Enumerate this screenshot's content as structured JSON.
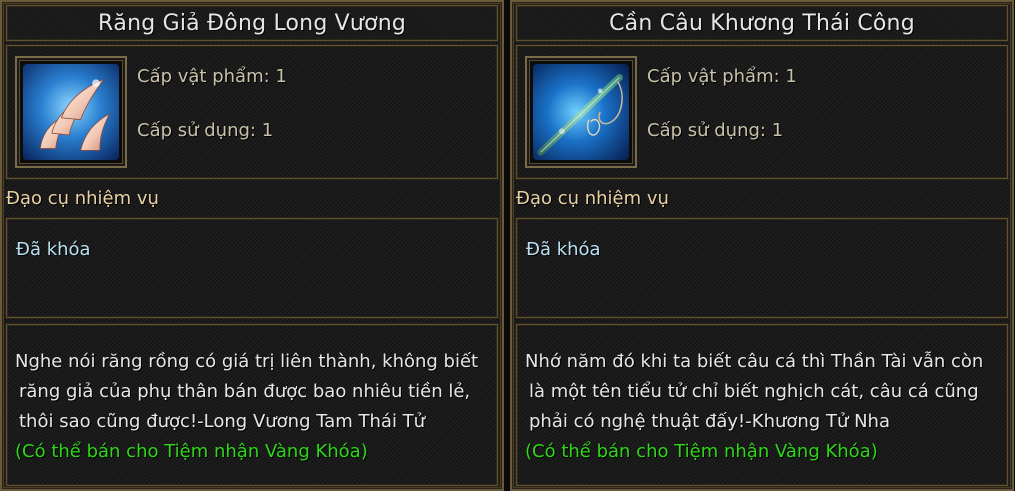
{
  "items": [
    {
      "name": "Răng Giả Đông Long Vương",
      "icon": "dragon-teeth-icon",
      "item_level_label": "Cấp vật phẩm: 1",
      "use_level_label": "Cấp sử dụng: 1",
      "category": "Đạo cụ nhiệm vụ",
      "lock_status": "Đã khóa",
      "description_lines": [
        "Nghe nói răng rồng có giá trị liên thành, không biết",
        "răng giả của phụ thân bán được bao nhiêu tiền lẻ,",
        "thôi sao cũng được!-Long Vương Tam Thái Tử"
      ],
      "sell_note": "(Có thể bán cho Tiệm nhận Vàng Khóa)"
    },
    {
      "name": "Cần Câu Khương Thái Công",
      "icon": "fishing-rod-icon",
      "item_level_label": "Cấp vật phẩm: 1",
      "use_level_label": "Cấp sử dụng: 1",
      "category": "Đạo cụ nhiệm vụ",
      "lock_status": "Đã khóa",
      "description_lines": [
        "Nhớ năm đó khi ta biết câu cá thì Thần Tài vẫn còn",
        "là một tên tiểu tử chỉ biết nghịch cát, câu cá cũng",
        "phải có nghệ thuật đấy!-Khương Tử Nha"
      ],
      "sell_note": "(Có thể bán cho Tiệm nhận Vàng Khóa)"
    }
  ],
  "colors": {
    "title": "#e6e6e6",
    "stat": "#c8c0a8",
    "category": "#e8d2a4",
    "lock": "#b9e0f2",
    "sell": "#2fd61a",
    "border": "#6b5a38"
  }
}
